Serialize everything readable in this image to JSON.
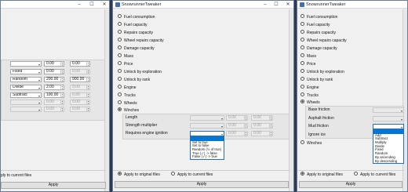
{
  "app_title": "SnowrunnerTweaker",
  "window_controls": {
    "minimize": "–",
    "maximize": "☐",
    "close": "✕"
  },
  "left": {
    "rows": [
      {
        "select": "",
        "num1": "0.00",
        "num2": "0.00"
      },
      {
        "select": "Fixed",
        "num1": "0.00",
        "num2": "0.00"
      },
      {
        "select": "Random",
        "num1": "200.00",
        "num2": "900.00"
      },
      {
        "select": "Divide",
        "num1": "2.00",
        "num2": "0.00"
      },
      {
        "select": "Subtract",
        "num1": "100.00",
        "num2": "0.00"
      },
      {
        "select": "",
        "num1": "0.00",
        "num2": "0.00"
      },
      {
        "select": "",
        "num1": "0.00",
        "num2": "0.00"
      }
    ],
    "apply_current_partial": "ply to current files",
    "apply_button": "Apply"
  },
  "middle": {
    "params": [
      "Fuel consumption",
      "Fuel capacity",
      "Repairs capacity",
      "Wheel repairs capacity",
      "Damage capacity",
      "Mass",
      "Price",
      "Unlock by exploration",
      "Unlock by rank",
      "Engine",
      "Trucks",
      "Wheels",
      "Winches"
    ],
    "selected": "Winches",
    "sub_rows": [
      {
        "label": "Length",
        "num1": "0.00",
        "num2": "0.00"
      },
      {
        "label": "Strength multiplier",
        "num1": "0.00",
        "num2": "0.00"
      },
      {
        "label": "Requires engine ignition",
        "num1": "0.00",
        "num2": "0.00"
      }
    ],
    "dropdown_options": [
      "",
      "Set to true",
      "Set to false",
      "Random (½ of true)",
      "True (✓) -> false",
      "False (✓) -> true"
    ],
    "apply_original": "Apply to original files",
    "apply_current": "Apply to current files",
    "apply_button": "Apply"
  },
  "right": {
    "params": [
      "Fuel consumption",
      "Fuel capacity",
      "Repairs capacity",
      "Wheel repairs capacity",
      "Damage capacity",
      "Mass",
      "Price",
      "Unlock by exploration",
      "Unlock by rank",
      "Engine",
      "Trucks",
      "Wheels"
    ],
    "selected": "Wheels",
    "sub_rows": [
      "Base friction",
      "Asphalt friction",
      "Mud friction",
      "Ignore ice"
    ],
    "dropdown_options": [
      "",
      "Add",
      "Subtract",
      "Multiply",
      "Divide",
      "Fixed",
      "Random",
      "By ascending",
      "By descending"
    ],
    "winches_label": "Winches",
    "apply_original": "Apply to original files",
    "apply_current": "Apply to current files",
    "apply_button": "Apply"
  }
}
